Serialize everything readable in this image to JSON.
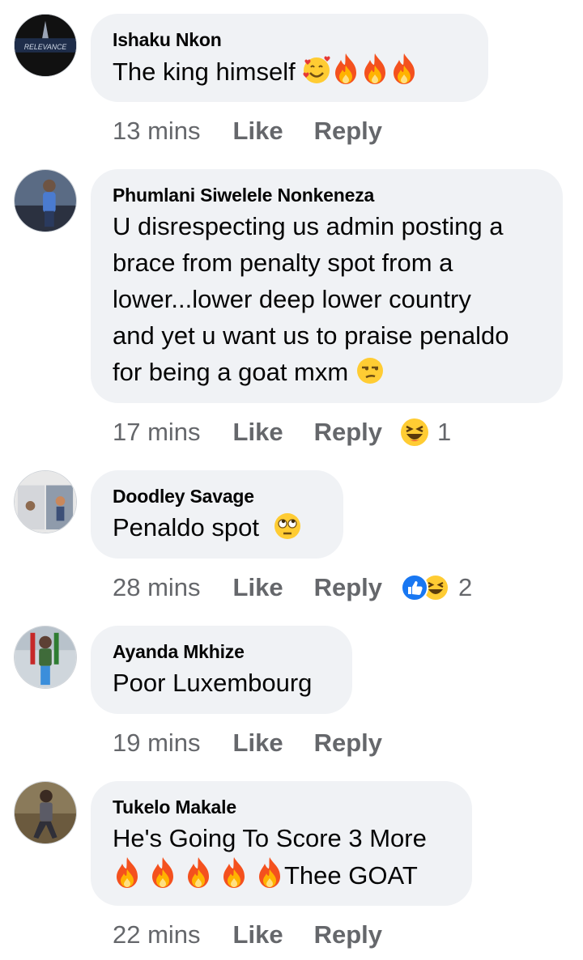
{
  "comments": [
    {
      "author": "Ishaku Nkon",
      "avatar_text": "RELEVANCE",
      "text": "The king himself",
      "time": "13 mins",
      "like_label": "Like",
      "reply_label": "Reply"
    },
    {
      "author": "Phumlani Siwelele Nonkeneza",
      "text_lines": [
        "U disrespecting us admin posting a",
        "brace from penalty spot from a",
        "lower...lower deep lower country",
        "and yet u want us to praise penaldo",
        "for being a goat mxm"
      ],
      "time": "17 mins",
      "like_label": "Like",
      "reply_label": "Reply",
      "reaction_count": "1"
    },
    {
      "author": "Doodley Savage",
      "text": "Penaldo spot",
      "time": "28 mins",
      "like_label": "Like",
      "reply_label": "Reply",
      "reaction_count": "2"
    },
    {
      "author": "Ayanda Mkhize",
      "text": "Poor Luxembourg",
      "time": "19 mins",
      "like_label": "Like",
      "reply_label": "Reply"
    },
    {
      "author": "Tukelo Makale",
      "text_line1": "He's Going To Score 3 More",
      "text_line2_suffix": "Thee GOAT",
      "time": "22 mins",
      "like_label": "Like",
      "reply_label": "Reply"
    }
  ],
  "colors": {
    "bubble": "#f0f2f5",
    "meta": "#65676b",
    "text": "#050505",
    "like_blue": "#1877f2",
    "emoji_yellow": "#ffcc33",
    "fire_orange": "#f4511e"
  }
}
